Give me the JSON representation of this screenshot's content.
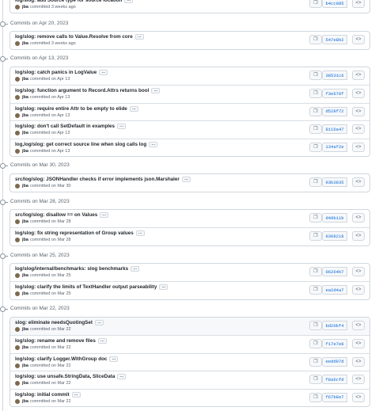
{
  "groups": [
    {
      "date": "",
      "commits": [
        {
          "message": "log/slog: add Source type for source location",
          "author": "jba",
          "when": "committed 3 weeks ago",
          "sha": "b4cc085"
        }
      ]
    },
    {
      "date": "Commits on Apr 20, 2023",
      "commits": [
        {
          "message": "log/slog: remove calls to Value.Resolve from core",
          "author": "jba",
          "when": "committed 3 weeks ago",
          "sha": "547e8b2"
        }
      ]
    },
    {
      "date": "Commits on Apr 13, 2023",
      "commits": [
        {
          "message": "log/slog: catch panics in LogValue",
          "author": "jba",
          "when": "committed on Apr 13",
          "sha": "38531c6"
        },
        {
          "message": "log/slog: function argument to Record.Attrs returns bool",
          "author": "jba",
          "when": "committed on Apr 13",
          "sha": "f3e670f"
        },
        {
          "message": "log/slog: require entire Attr to be empty to elide",
          "author": "jba",
          "when": "committed on Apr 13",
          "sha": "d528f72"
        },
        {
          "message": "log/slog: don't call SetDefault in examples",
          "author": "jba",
          "when": "committed on Apr 13",
          "sha": "8116a47"
        },
        {
          "message": "log,log/slog: get correct source line when slog calls log",
          "author": "jba",
          "when": "committed on Apr 13",
          "sha": "134af2e"
        }
      ]
    },
    {
      "date": "Commits on Mar 30, 2023",
      "commits": [
        {
          "message": "src/log/slog: JSONHandler checks if error implements json.Marshaler",
          "author": "jba",
          "when": "committed on Mar 30",
          "sha": "93b3835"
        }
      ]
    },
    {
      "date": "Commits on Mar 28, 2023",
      "commits": [
        {
          "message": "src/log/slog: disallow == on Values",
          "author": "jba",
          "when": "committed on Mar 28",
          "sha": "d49b11b"
        },
        {
          "message": "log/slog: fix string representation of Group values",
          "author": "jba",
          "when": "committed on Mar 28",
          "sha": "9368218"
        }
      ]
    },
    {
      "date": "Commits on Mar 25, 2023",
      "commits": [
        {
          "message": "log/slog/internal/benchmarks: slog benchmarks",
          "author": "jba",
          "when": "committed on Mar 25",
          "sha": "06264b7"
        },
        {
          "message": "log/slog: clarify the limits of TextHandler output parseability",
          "author": "jba",
          "when": "committed on Mar 25",
          "sha": "ea2d4a7"
        }
      ]
    },
    {
      "date": "Commits on Mar 22, 2023",
      "commits": [
        {
          "message": "slog: eliminate needsQuotingSet",
          "author": "jba",
          "when": "committed on Mar 22",
          "sha": "bd20bf4"
        },
        {
          "message": "log/slog: rename and remove files",
          "author": "jba",
          "when": "committed on Mar 22",
          "sha": "f17e7e8"
        },
        {
          "message": "log/slog: clarify Logger.WithGroup doc",
          "author": "jba",
          "when": "committed on Mar 22",
          "sha": "eedd97d"
        },
        {
          "message": "log/slog: use unsafe.StringData, SliceData",
          "author": "jba",
          "when": "committed on Mar 22",
          "sha": "f8a6cfd"
        },
        {
          "message": "log/slog: initial commit",
          "author": "jba",
          "when": "committed on Mar 22",
          "sha": "f67b8e7"
        }
      ]
    }
  ],
  "labels": {
    "ellipsis": "…",
    "copy_icon": "copy-icon",
    "browse_icon": "code-icon"
  },
  "colors": {
    "sha_link": "#0969da",
    "border": "#d0d7de",
    "muted": "#59636e"
  }
}
